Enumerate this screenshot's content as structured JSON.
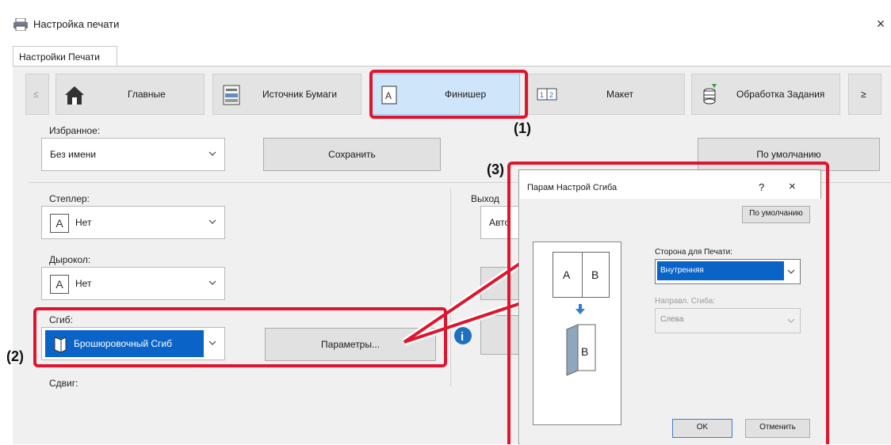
{
  "window": {
    "title": "Настройка печати",
    "close_glyph": "×"
  },
  "tab": {
    "label": "Настройки Печати"
  },
  "toolbar": {
    "prev": "≤",
    "next": "≥",
    "items": [
      {
        "label": "Главные",
        "icon": "home-icon"
      },
      {
        "label": "Источник Бумаги",
        "icon": "paper-tray-icon"
      },
      {
        "label": "Финишер",
        "icon": "finisher-icon"
      },
      {
        "label": "Макет",
        "icon": "layout-icon"
      },
      {
        "label": "Обработка Задания",
        "icon": "job-handling-icon"
      }
    ]
  },
  "favorites": {
    "label": "Избранное:",
    "value": "Без имени",
    "save": "Сохранить",
    "default": "По умолчанию"
  },
  "stapler": {
    "label": "Степлер:",
    "value": "Нет"
  },
  "punch": {
    "label": "Дырокол:",
    "value": "Нет"
  },
  "fold": {
    "label": "Сгиб:",
    "value": "Брошюровочный Сгиб",
    "params": "Параметры..."
  },
  "shift": {
    "label": "Сдвиг:"
  },
  "output": {
    "label": "Выход",
    "value": "Авто"
  },
  "info_glyph": "i",
  "dialog": {
    "title": "Парам Настрой Сгиба",
    "help": "?",
    "close": "×",
    "default": "По умолчанию",
    "print_side_label": "Сторона для Печати:",
    "print_side_value": "Внутренняя",
    "direction_label": "Направл. Сгиба:",
    "direction_value": "Слева",
    "preview": {
      "left": "A",
      "right": "B",
      "folded": "B"
    },
    "ok": "OK",
    "cancel": "Отменить"
  },
  "callouts": {
    "one": "(1)",
    "two": "(2)",
    "three": "(3)"
  },
  "colors": {
    "accent": "#e0142d",
    "selection": "#0a64c8",
    "active_tab": "#cfe5fa"
  }
}
